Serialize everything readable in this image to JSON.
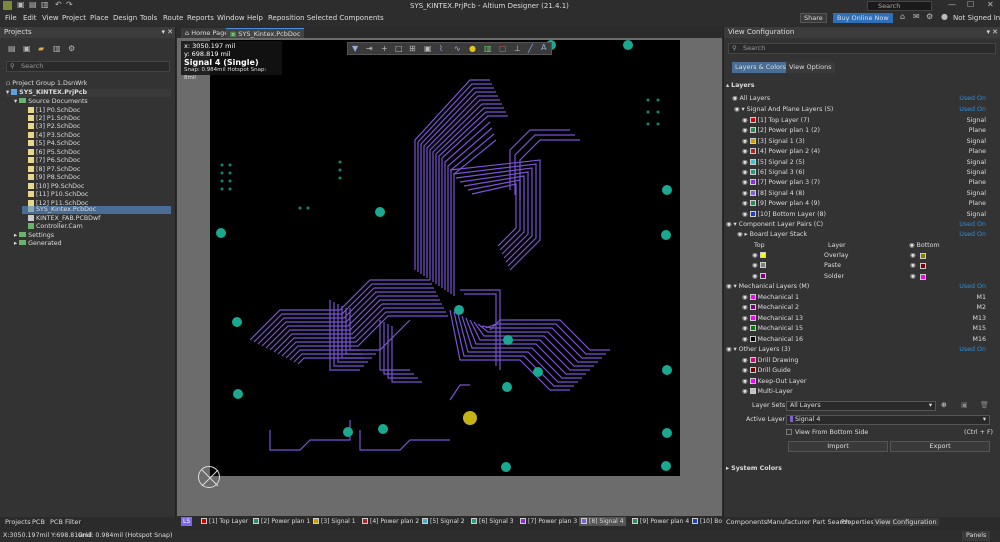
{
  "titlebar": {
    "title": "SYS_KINTEX.PrjPcb - Altium Designer (21.4.1)",
    "search_placeholder": "Search"
  },
  "menu": [
    "File",
    "Edit",
    "View",
    "Project",
    "Place",
    "Design",
    "Tools",
    "Route",
    "Reports",
    "Window",
    "Help",
    "Reposition Selected Components"
  ],
  "header_right": {
    "share": "Share",
    "buy": "Buy Online Now",
    "user": "Not Signed In"
  },
  "projects_panel": {
    "title": "Projects",
    "search_placeholder": "Search",
    "tree": [
      "Project Group 1.DsnWrk",
      "SYS_KINTEX.PrjPcb",
      "Source Documents",
      "[1] P0.SchDoc",
      "[2] P1.SchDoc",
      "[3] P2.SchDoc",
      "[4] P3.SchDoc",
      "[5] P4.SchDoc",
      "[6] P5.SchDoc",
      "[7] P6.SchDoc",
      "[8] P7.SchDoc",
      "[9] P8.SchDoc",
      "[10] P9.SchDoc",
      "[11] P10.SchDoc",
      "[12] P11.SchDoc",
      "SYS_Kintex.PcbDoc",
      "KINTEX_FAB.PCBDwf",
      "Controller.Cam",
      "Settings",
      "Generated"
    ],
    "bottom_tabs": [
      "Projects",
      "PCB",
      "PCB Filter"
    ]
  },
  "doc_tabs": [
    "Home Page",
    "SYS_Kintex.PcbDoc"
  ],
  "info": {
    "x": "x:  3050.197 mil",
    "y": "y:   698.819  mil",
    "layer": "Signal 4 (Single)",
    "snap": "Snap: 0.984mil Hotspot Snap: 8mil"
  },
  "layer_tabs": [
    {
      "label": "LS",
      "color": "#7b68ee"
    },
    {
      "label": "[1] Top Layer",
      "color": "#cc0000"
    },
    {
      "label": "[2] Power plan 1",
      "color": "#2e8b57"
    },
    {
      "label": "[3] Signal 1",
      "color": "#c8a000"
    },
    {
      "label": "[4] Power plan 2",
      "color": "#b22222"
    },
    {
      "label": "[5] Signal 2",
      "color": "#40b0c0"
    },
    {
      "label": "[6] Signal 3",
      "color": "#20a080"
    },
    {
      "label": "[7] Power plan 3",
      "color": "#8a2be2"
    },
    {
      "label": "[8] Signal 4",
      "color": "#8060d0"
    },
    {
      "label": "[9] Power plan 4",
      "color": "#2e8b57"
    },
    {
      "label": "[10] Bo",
      "color": "#1e40c0"
    }
  ],
  "view_config": {
    "title": "View Configuration",
    "search_placeholder": "Search",
    "tabs": [
      "Layers & Colors",
      "View Options"
    ],
    "section_layers": "Layers",
    "all_layers": "All Layers",
    "used_on": "Used On",
    "signal_group": "Signal And Plane Layers (S)",
    "signal_layers": [
      {
        "name": "[1] Top Layer (7)",
        "type": "Signal",
        "color": "#e00000"
      },
      {
        "name": "[2] Power plan 1 (2)",
        "type": "Plane",
        "color": "#2e8b57"
      },
      {
        "name": "[3] Signal 1 (3)",
        "type": "Signal",
        "color": "#c8a000"
      },
      {
        "name": "[4] Power plan 2 (4)",
        "type": "Plane",
        "color": "#b22222"
      },
      {
        "name": "[5] Signal 2 (5)",
        "type": "Signal",
        "color": "#40c0d0"
      },
      {
        "name": "[6] Signal 3 (6)",
        "type": "Signal",
        "color": "#20a080"
      },
      {
        "name": "[7] Power plan 3 (7)",
        "type": "Plane",
        "color": "#8a2be2"
      },
      {
        "name": "[8] Signal 4 (8)",
        "type": "Signal",
        "color": "#8060d0"
      },
      {
        "name": "[9] Power plan 4 (9)",
        "type": "Plane",
        "color": "#2e8b57"
      },
      {
        "name": "[10] Bottom Layer (8)",
        "type": "Signal",
        "color": "#1e40c0"
      }
    ],
    "comp_group": "Component Layer Pairs (C)",
    "board_stack": "Board Layer Stack",
    "comp_headers": {
      "top": "Top",
      "layer": "Layer",
      "bottom": "Bottom"
    },
    "comp_layers": [
      {
        "name": "Overlay",
        "top": "#ffff00",
        "bottom": "#808000"
      },
      {
        "name": "Paste",
        "top": "#808080",
        "bottom": "#800000"
      },
      {
        "name": "Solder",
        "top": "#800080",
        "bottom": "#ff00ff"
      }
    ],
    "mech_group": "Mechanical Layers (M)",
    "mech_layers": [
      {
        "name": "Mechanical 1",
        "code": "M1",
        "color": "#ff00ff"
      },
      {
        "name": "Mechanical 2",
        "code": "M2",
        "color": "#800080"
      },
      {
        "name": "Mechanical 13",
        "code": "M13",
        "color": "#ff00ff"
      },
      {
        "name": "Mechanical 15",
        "code": "M15",
        "color": "#008000"
      },
      {
        "name": "Mechanical 16",
        "code": "M16",
        "color": "#000000"
      }
    ],
    "other_group": "Other Layers (3)",
    "other_layers": [
      {
        "name": "Drill Drawing",
        "color": "#e0007f"
      },
      {
        "name": "Drill Guide",
        "color": "#800000"
      },
      {
        "name": "Keep-Out Layer",
        "color": "#ff00ff"
      },
      {
        "name": "Multi-Layer",
        "color": "#c0c0c0"
      }
    ],
    "layer_sets_label": "Layer Sets",
    "layer_sets_value": "All Layers",
    "active_layer_label": "Active Layer",
    "active_layer_value": "Signal 4",
    "view_from_bottom": "View From Bottom Side",
    "shortcut": "(Ctrl + F)",
    "import": "Import",
    "export": "Export",
    "system_colors": "System Colors",
    "bottom_tabs": [
      "Components",
      "Manufacturer Part Search",
      "Properties",
      "View Configuration"
    ]
  },
  "status": {
    "coords": "X:3050.197mil Y:698.819mil",
    "grid": "Grid: 0.984mil",
    "snap": "(Hotspot Snap)",
    "panels": "Panels"
  }
}
